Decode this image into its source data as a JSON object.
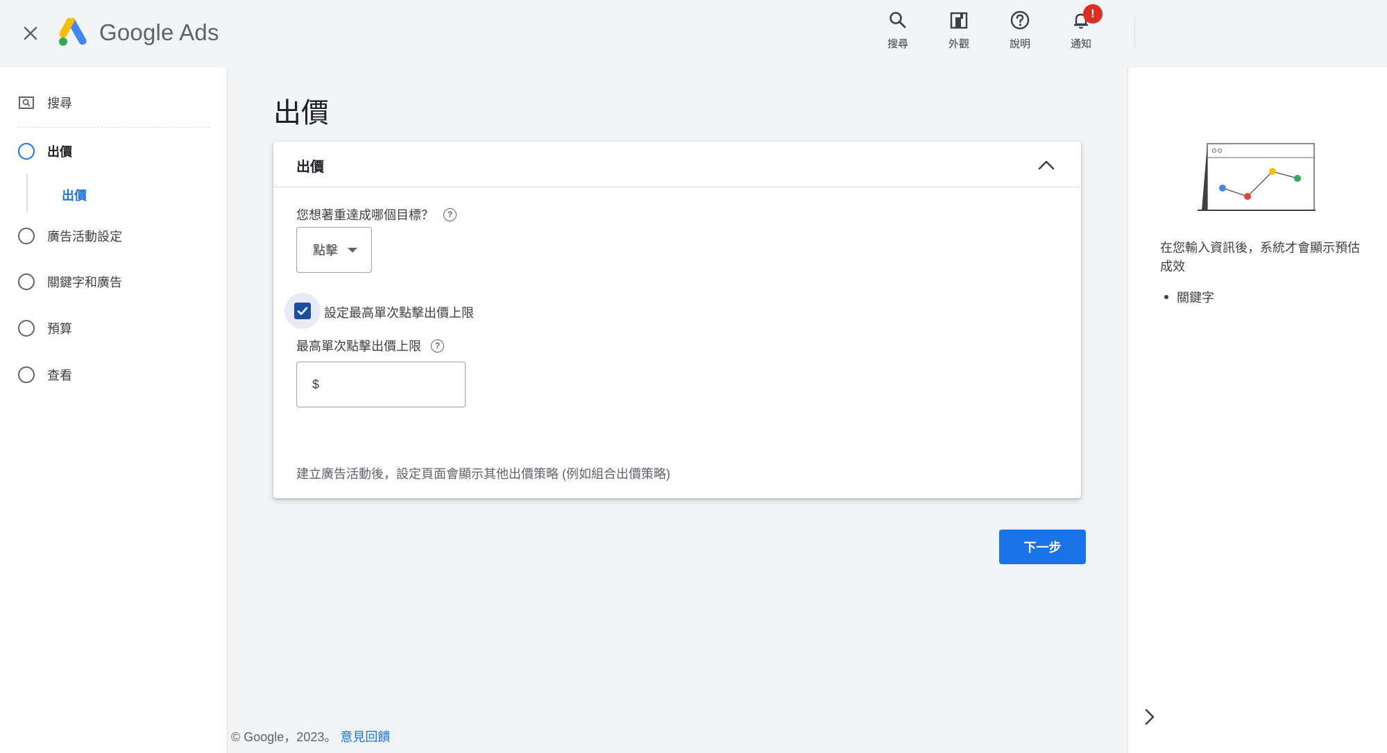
{
  "header": {
    "brand_google": "Google",
    "brand_ads": "Ads",
    "actions": [
      {
        "label": "搜尋",
        "icon": "search-icon"
      },
      {
        "label": "外觀",
        "icon": "appearance-icon"
      },
      {
        "label": "說明",
        "icon": "help-icon"
      },
      {
        "label": "通知",
        "icon": "bell-icon"
      }
    ],
    "notification_badge": "!"
  },
  "sidebar": {
    "search_label": "搜尋",
    "steps": [
      {
        "label": "出價",
        "active": true
      },
      {
        "label": "廣告活動設定"
      },
      {
        "label": "關鍵字和廣告"
      },
      {
        "label": "預算"
      },
      {
        "label": "查看"
      }
    ],
    "substep_label": "出價"
  },
  "main": {
    "page_title": "出價",
    "card": {
      "title": "出價",
      "question": "您想著重達成哪個目標？",
      "select_value": "點擊",
      "checkbox_label": "設定最高單次點擊出價上限",
      "checkbox_checked": true,
      "max_cpc_label": "最高單次點擊出價上限",
      "currency_symbol": "$",
      "max_cpc_value": "",
      "note": "建立廣告活動後，設定頁面會顯示其他出價策略 (例如組合出價策略)"
    },
    "next_button": "下一步"
  },
  "footer": {
    "copyright": "© Google，2023。",
    "feedback_link": "意見回饋"
  },
  "right_panel": {
    "text": "在您輸入資訊後，系統才會顯示預估成效",
    "list": [
      "關鍵字"
    ]
  },
  "colors": {
    "accent": "#1a73e8",
    "badge": "#d93025",
    "checkbox": "#1a4fa0"
  }
}
